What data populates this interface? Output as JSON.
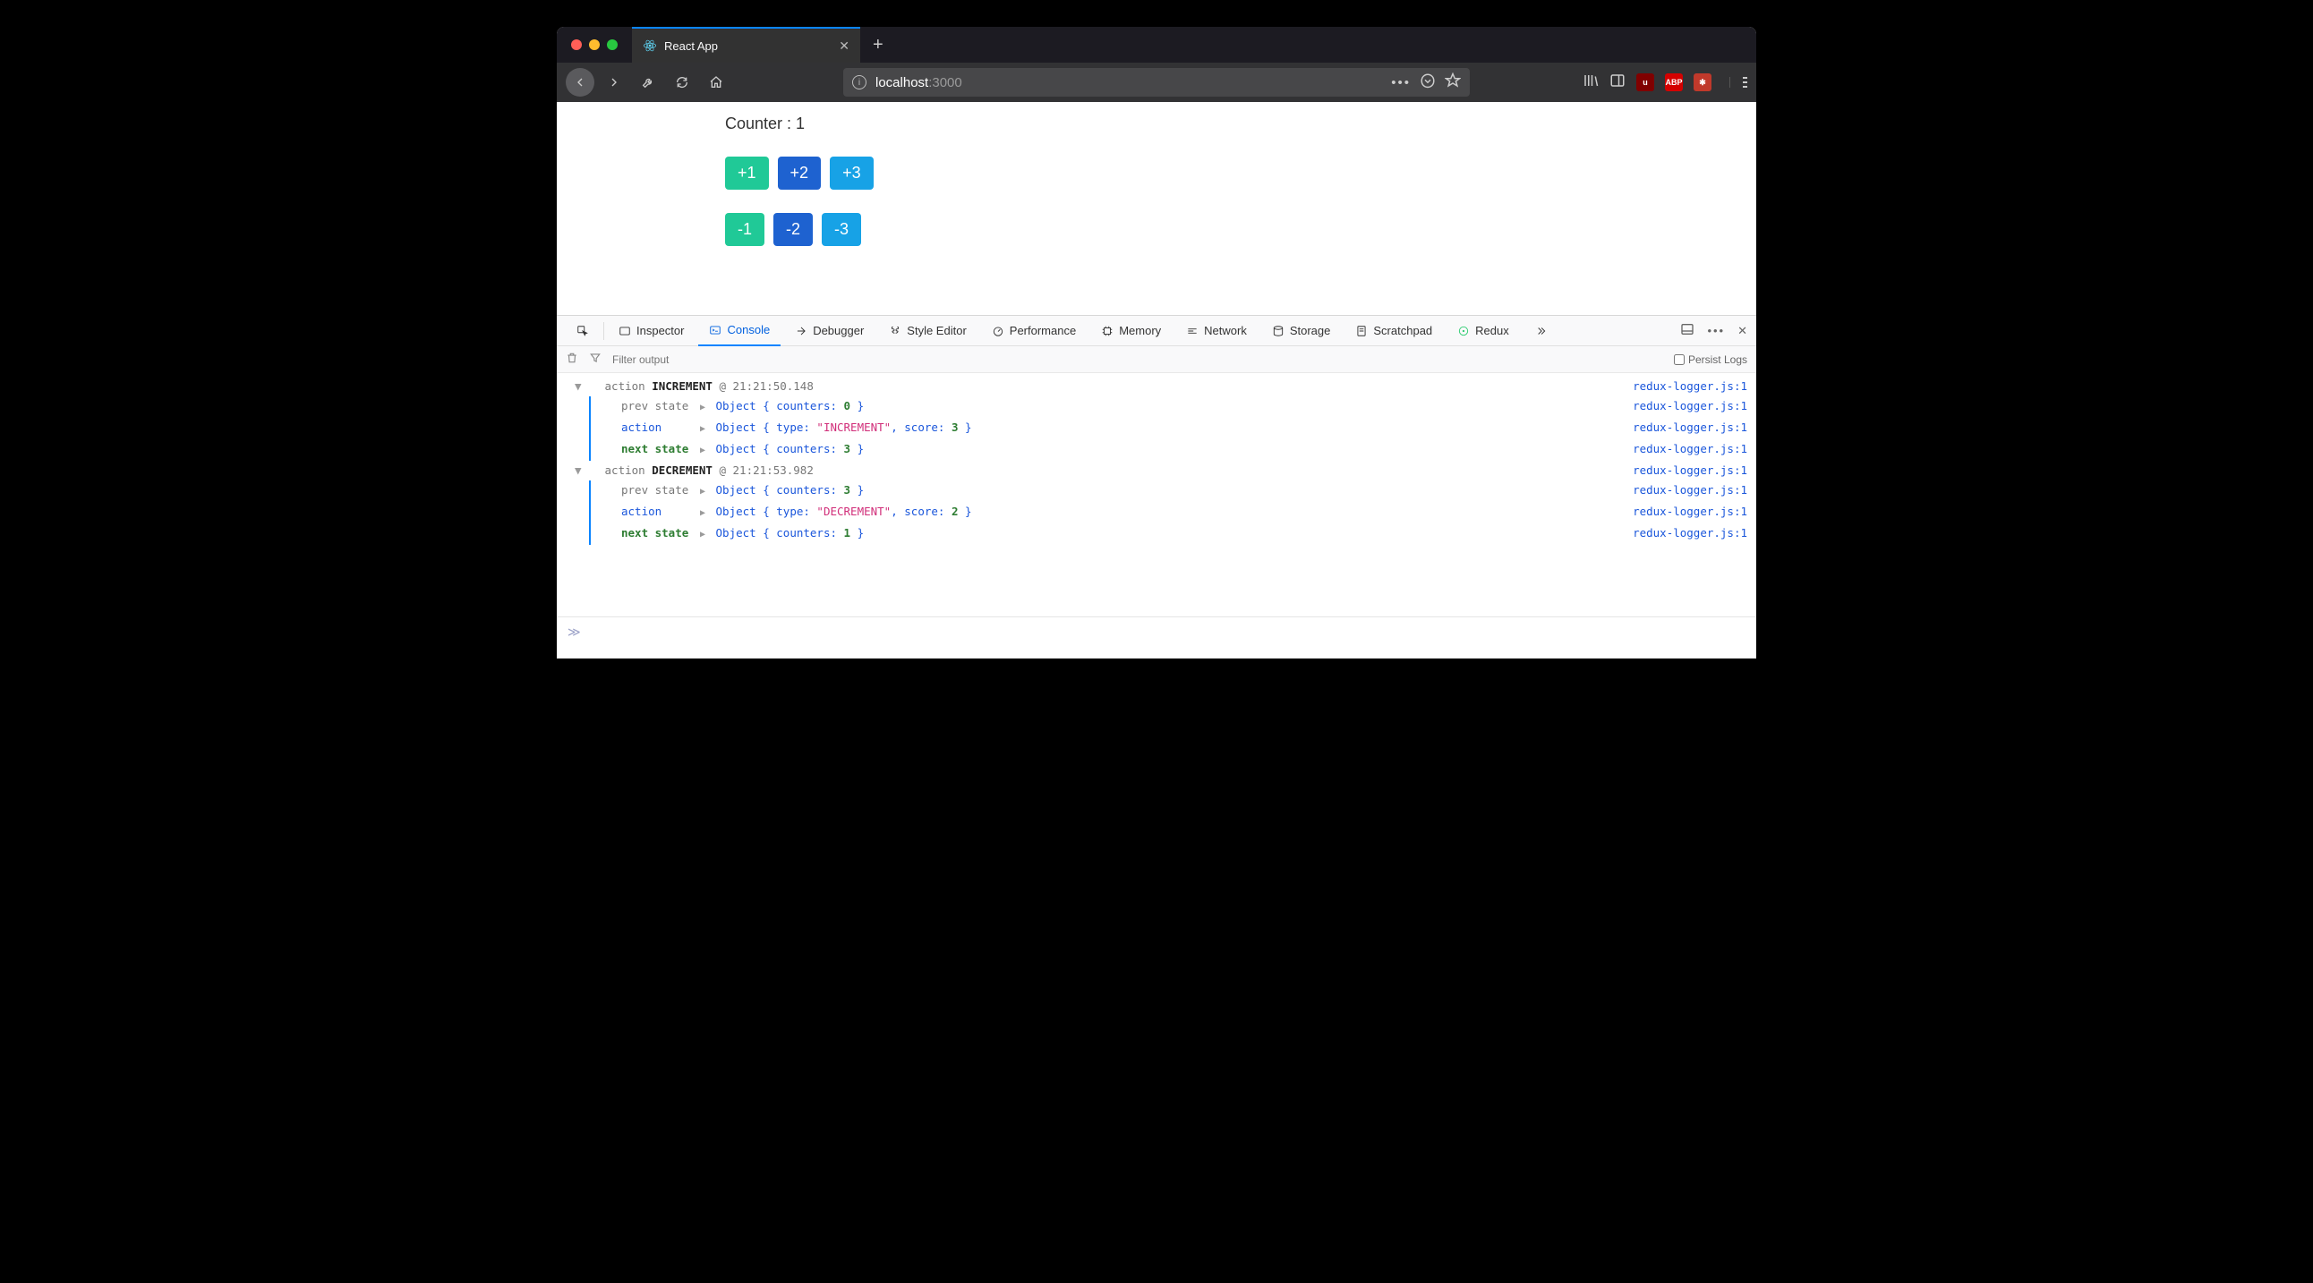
{
  "browser": {
    "tab_title": "React App",
    "url_host": "localhost",
    "url_port": ":3000"
  },
  "app": {
    "counter_label": "Counter : ",
    "counter_value": "1",
    "buttons_inc": [
      "+1",
      "+2",
      "+3"
    ],
    "buttons_dec": [
      "-1",
      "-2",
      "-3"
    ]
  },
  "devtools": {
    "tabs": [
      "Inspector",
      "Console",
      "Debugger",
      "Style Editor",
      "Performance",
      "Memory",
      "Network",
      "Storage",
      "Scratchpad",
      "Redux"
    ],
    "active_tab": "Console",
    "filter_placeholder": "Filter output",
    "persist_label": "Persist Logs",
    "source": "redux-logger.js:1"
  },
  "logs": [
    {
      "header_prefix": "action",
      "header_type": "INCREMENT",
      "header_time": "@ 21:21:50.148",
      "prev_state": {
        "label": "prev state",
        "obj_prefix": "Object { ",
        "kv": "counters: ",
        "val": "0",
        "obj_suffix": " }"
      },
      "action": {
        "label": "action",
        "obj_prefix": "Object { ",
        "kv1": "type: ",
        "str": "\"INCREMENT\"",
        "sep": ", ",
        "kv2": "score: ",
        "val": "3",
        "obj_suffix": " }"
      },
      "next_state": {
        "label": "next state",
        "obj_prefix": "Object { ",
        "kv": "counters: ",
        "val": "3",
        "obj_suffix": " }"
      }
    },
    {
      "header_prefix": "action",
      "header_type": "DECREMENT",
      "header_time": "@ 21:21:53.982",
      "prev_state": {
        "label": "prev state",
        "obj_prefix": "Object { ",
        "kv": "counters: ",
        "val": "3",
        "obj_suffix": " }"
      },
      "action": {
        "label": "action",
        "obj_prefix": "Object { ",
        "kv1": "type: ",
        "str": "\"DECREMENT\"",
        "sep": ", ",
        "kv2": "score: ",
        "val": "2",
        "obj_suffix": " }"
      },
      "next_state": {
        "label": "next state",
        "obj_prefix": "Object { ",
        "kv": "counters: ",
        "val": "1",
        "obj_suffix": " }"
      }
    }
  ]
}
